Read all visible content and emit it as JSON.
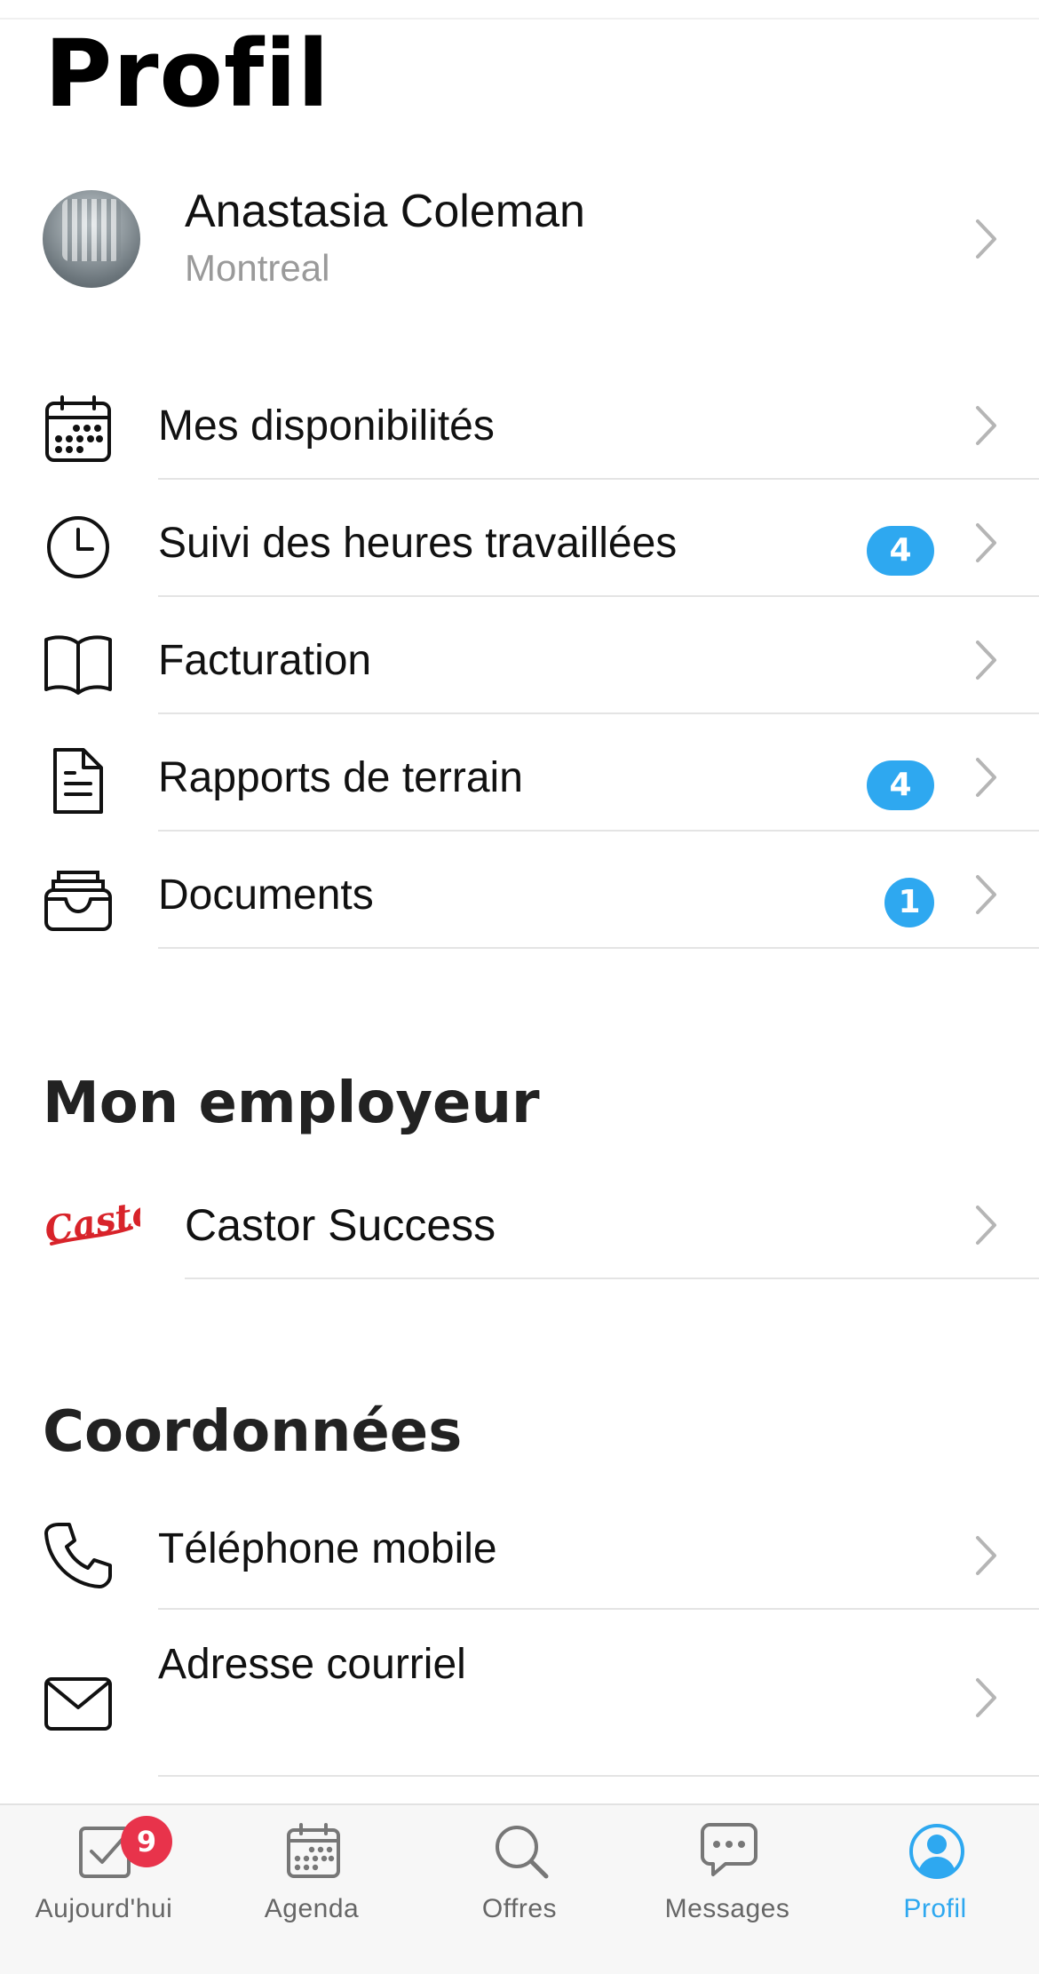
{
  "page": {
    "title": "Profil"
  },
  "profile": {
    "name": "Anastasia Coleman",
    "city": "Montreal"
  },
  "menu": [
    {
      "label": "Mes disponibilités",
      "icon": "calendar-icon",
      "badge": ""
    },
    {
      "label": "Suivi des heures travaillées",
      "icon": "clock-icon",
      "badge": "4"
    },
    {
      "label": "Facturation",
      "icon": "book-icon",
      "badge": ""
    },
    {
      "label": "Rapports de terrain",
      "icon": "document-icon",
      "badge": "4"
    },
    {
      "label": "Documents",
      "icon": "inbox-tray-icon",
      "badge": "1"
    }
  ],
  "employer": {
    "section_title": "Mon employeur",
    "name": "Castor Success",
    "logo_text": "Castor"
  },
  "contact": {
    "section_title": "Coordonnées",
    "items": [
      {
        "label": "Téléphone mobile",
        "icon": "phone-icon"
      },
      {
        "label": "Adresse courriel",
        "icon": "envelope-icon"
      }
    ]
  },
  "tabbar": {
    "tabs": [
      {
        "label": "Aujourd'hui",
        "icon": "checkbox-icon",
        "badge": "9"
      },
      {
        "label": "Agenda",
        "icon": "calendar-icon"
      },
      {
        "label": "Offres",
        "icon": "search-icon"
      },
      {
        "label": "Messages",
        "icon": "chat-bubble-icon"
      },
      {
        "label": "Profil",
        "icon": "user-circle-icon",
        "active": true
      }
    ]
  },
  "colors": {
    "accent": "#2ea8f0",
    "badge_red": "#e8334b",
    "brand_red": "#d8232a"
  }
}
